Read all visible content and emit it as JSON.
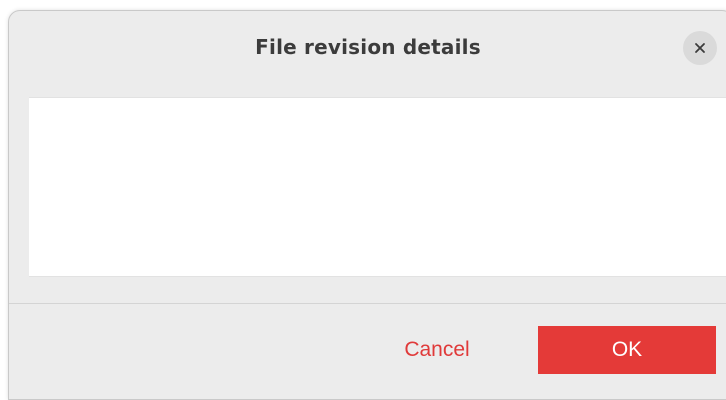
{
  "dialog": {
    "title": "File revision details",
    "close_icon": "close-icon",
    "buttons": {
      "cancel_label": "Cancel",
      "ok_label": "OK"
    }
  },
  "colors": {
    "accent": "#e43a38",
    "cancel_text": "#e03a3a",
    "dialog_background": "#ececec",
    "content_background": "#ffffff"
  }
}
